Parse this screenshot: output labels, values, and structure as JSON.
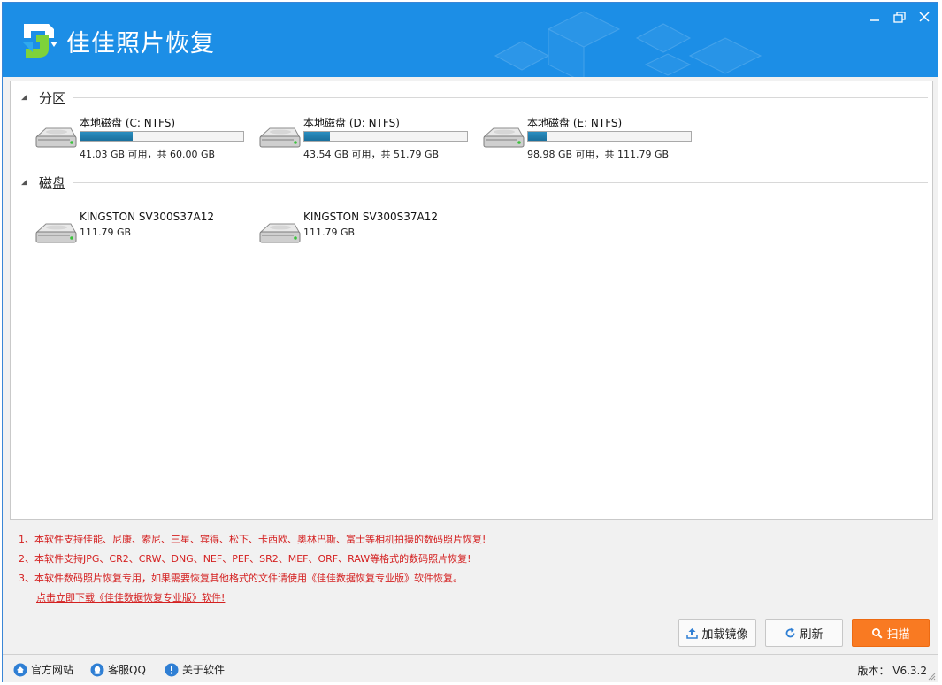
{
  "app": {
    "title": "佳佳照片恢复",
    "accent": "#1c8ee6"
  },
  "window_controls": {
    "minimize": "minimize-icon",
    "restore": "restore-icon",
    "close": "close-icon"
  },
  "sections": {
    "partitions": {
      "label": "分区",
      "toggle_icon": "collapse-triangle-icon"
    },
    "disks": {
      "label": "磁盘",
      "toggle_icon": "collapse-triangle-icon"
    }
  },
  "partitions": [
    {
      "name": "本地磁盘 (C: NTFS)",
      "size_text": "41.03 GB 可用，共 60.00 GB",
      "used_fraction": 0.32
    },
    {
      "name": "本地磁盘 (D: NTFS)",
      "size_text": "43.54 GB 可用，共 51.79 GB",
      "used_fraction": 0.16
    },
    {
      "name": "本地磁盘 (E: NTFS)",
      "size_text": "98.98 GB 可用，共 111.79 GB",
      "used_fraction": 0.115
    }
  ],
  "disks": [
    {
      "name": "KINGSTON  SV300S37A12",
      "size_text": "111.79 GB"
    },
    {
      "name": "KINGSTON  SV300S37A12",
      "size_text": "111.79 GB"
    }
  ],
  "notices": {
    "line1": "1、本软件支持佳能、尼康、索尼、三星、宾得、松下、卡西欧、奥林巴斯、富士等相机拍摄的数码照片恢复!",
    "line2": "2、本软件支持JPG、CR2、CRW、DNG、NEF、PEF、SR2、MEF、ORF、RAW等格式的数码照片恢复!",
    "line3": "3、本软件数码照片恢复专用，如果需要恢复其他格式的文件请使用《佳佳数据恢复专业版》软件恢复。",
    "download_link": "点击立即下载《佳佳数据恢复专业版》软件!",
    "color": "#d42020"
  },
  "buttons": {
    "load_image": "加载镜像",
    "refresh": "刷新",
    "scan": "扫描",
    "scan_color": "#f97a22"
  },
  "statusbar": {
    "website": "官方网站",
    "support_qq": "客服QQ",
    "about": "关于软件",
    "version": "版本： V6.3.2"
  }
}
